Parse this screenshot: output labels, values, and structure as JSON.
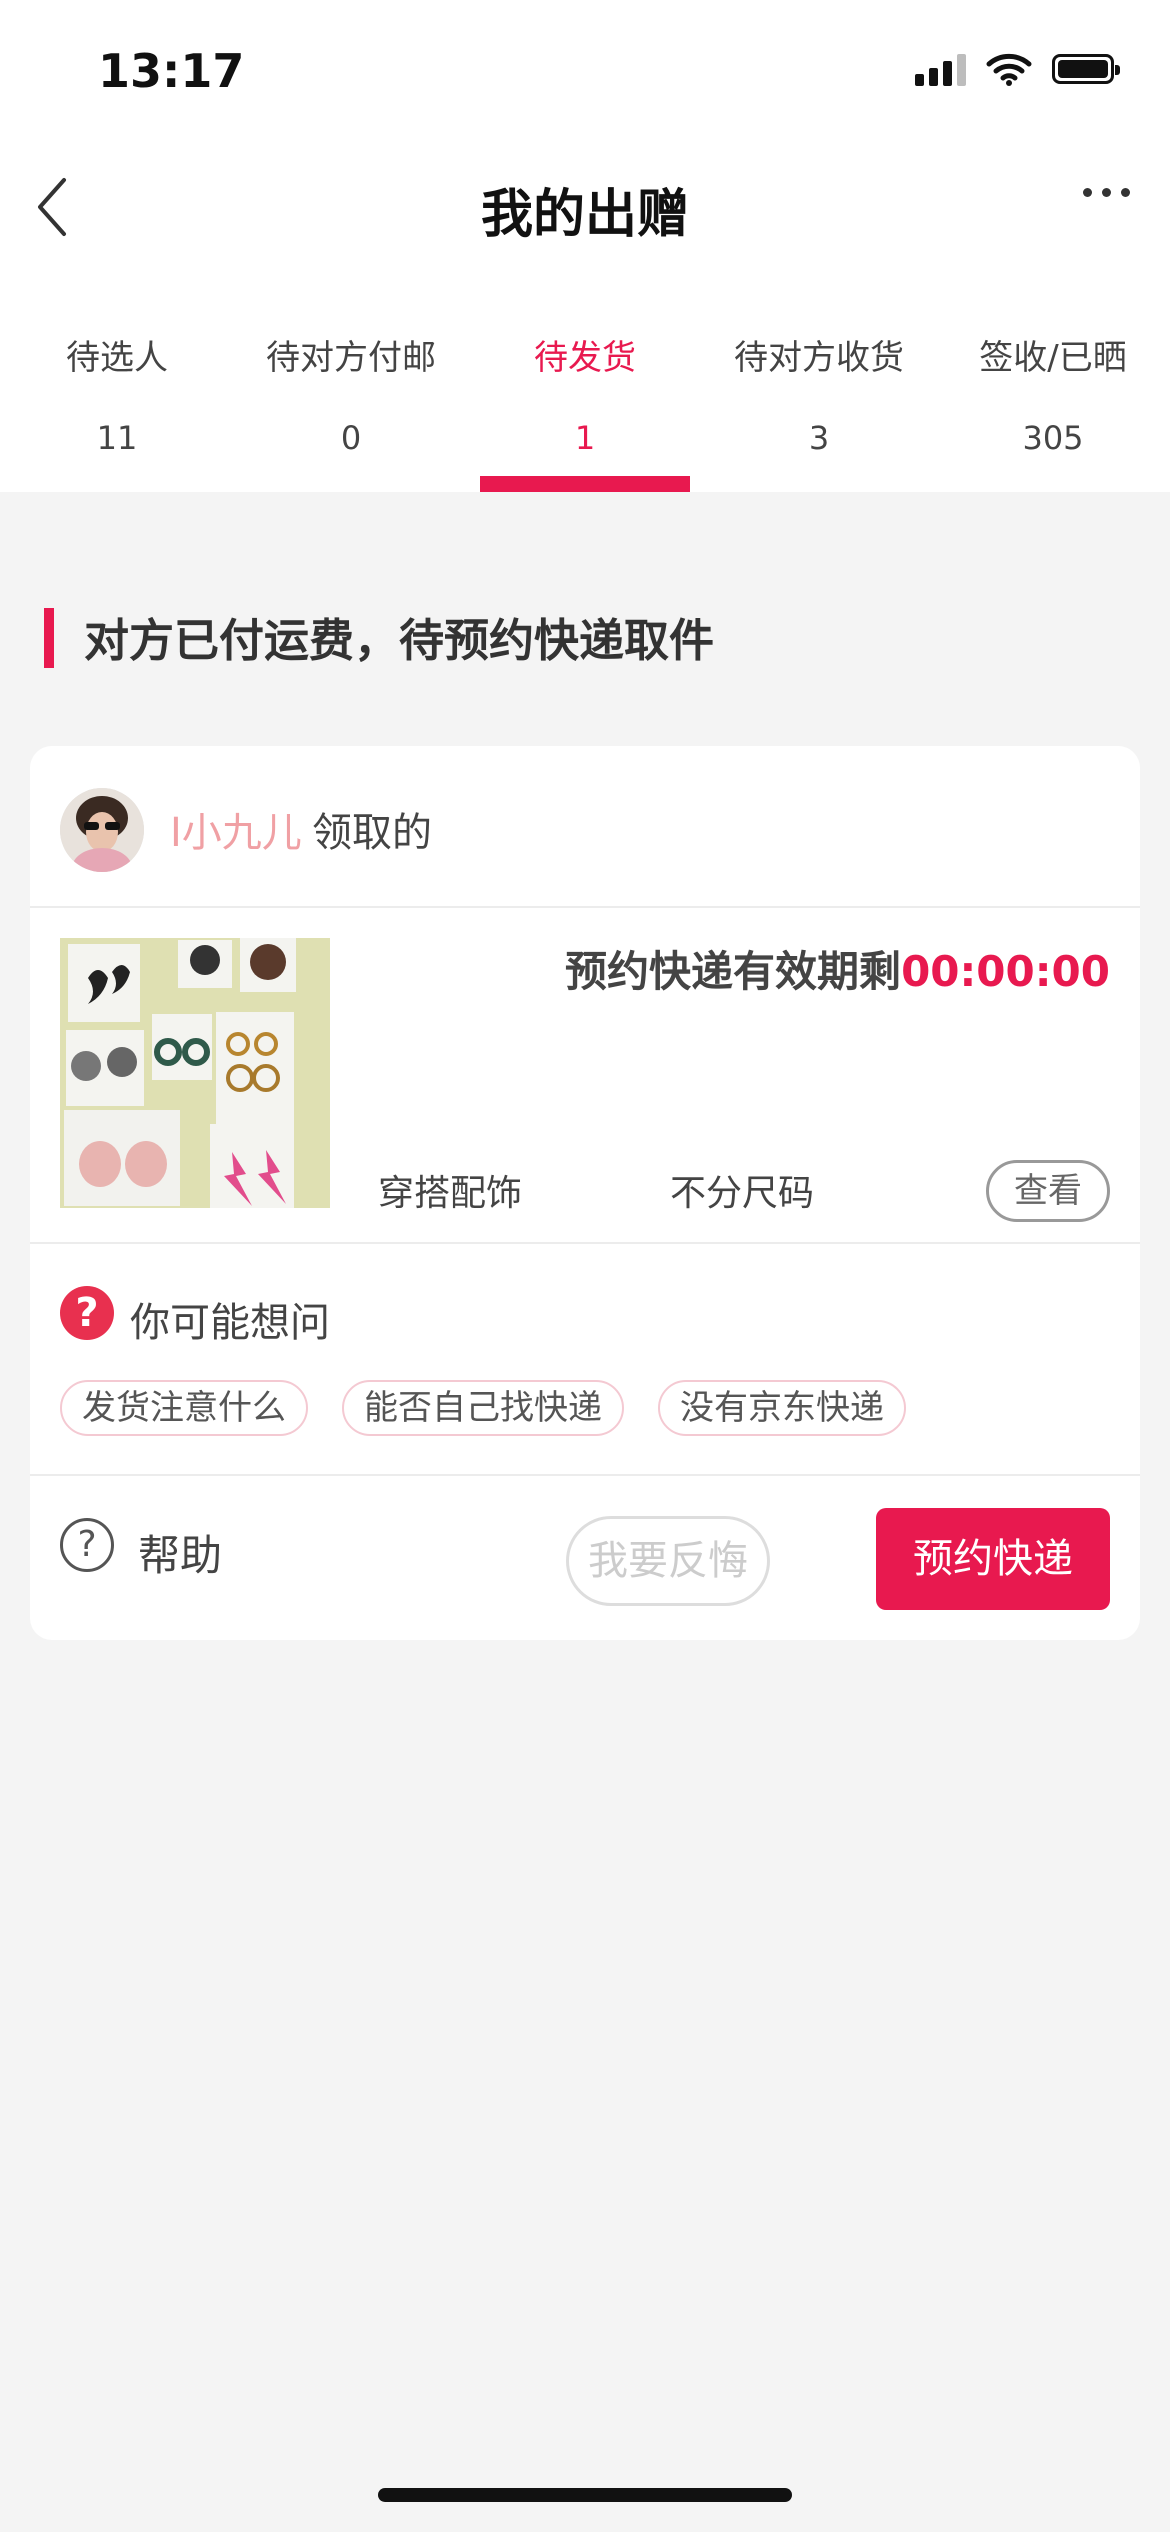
{
  "status_bar": {
    "time": "13:17"
  },
  "nav": {
    "title": "我的出赠"
  },
  "tabs": [
    {
      "label": "待选人",
      "count": "11"
    },
    {
      "label": "待对方付邮",
      "count": "0"
    },
    {
      "label": "待发货",
      "count": "1",
      "active": true
    },
    {
      "label": "待对方收货",
      "count": "3"
    },
    {
      "label": "签收/已晒",
      "count": "305"
    }
  ],
  "section": {
    "title": "对方已付运费，待预约快递取件"
  },
  "order": {
    "username": "I小九儿",
    "claimed_text": "领取的",
    "deadline_label": "预约快递有效期剩",
    "deadline_time": "00:00:00",
    "category": "穿搭配饰",
    "size": "不分尺码",
    "view_label": "查看"
  },
  "faq": {
    "title": "你可能想问",
    "chips": [
      "发货注意什么",
      "能否自己找快递",
      "没有京东快递"
    ]
  },
  "actions": {
    "help_label": "帮助",
    "regret_label": "我要反悔",
    "book_label": "预约快递"
  },
  "colors": {
    "accent": "#e8194f",
    "username": "#f0a0a4"
  }
}
